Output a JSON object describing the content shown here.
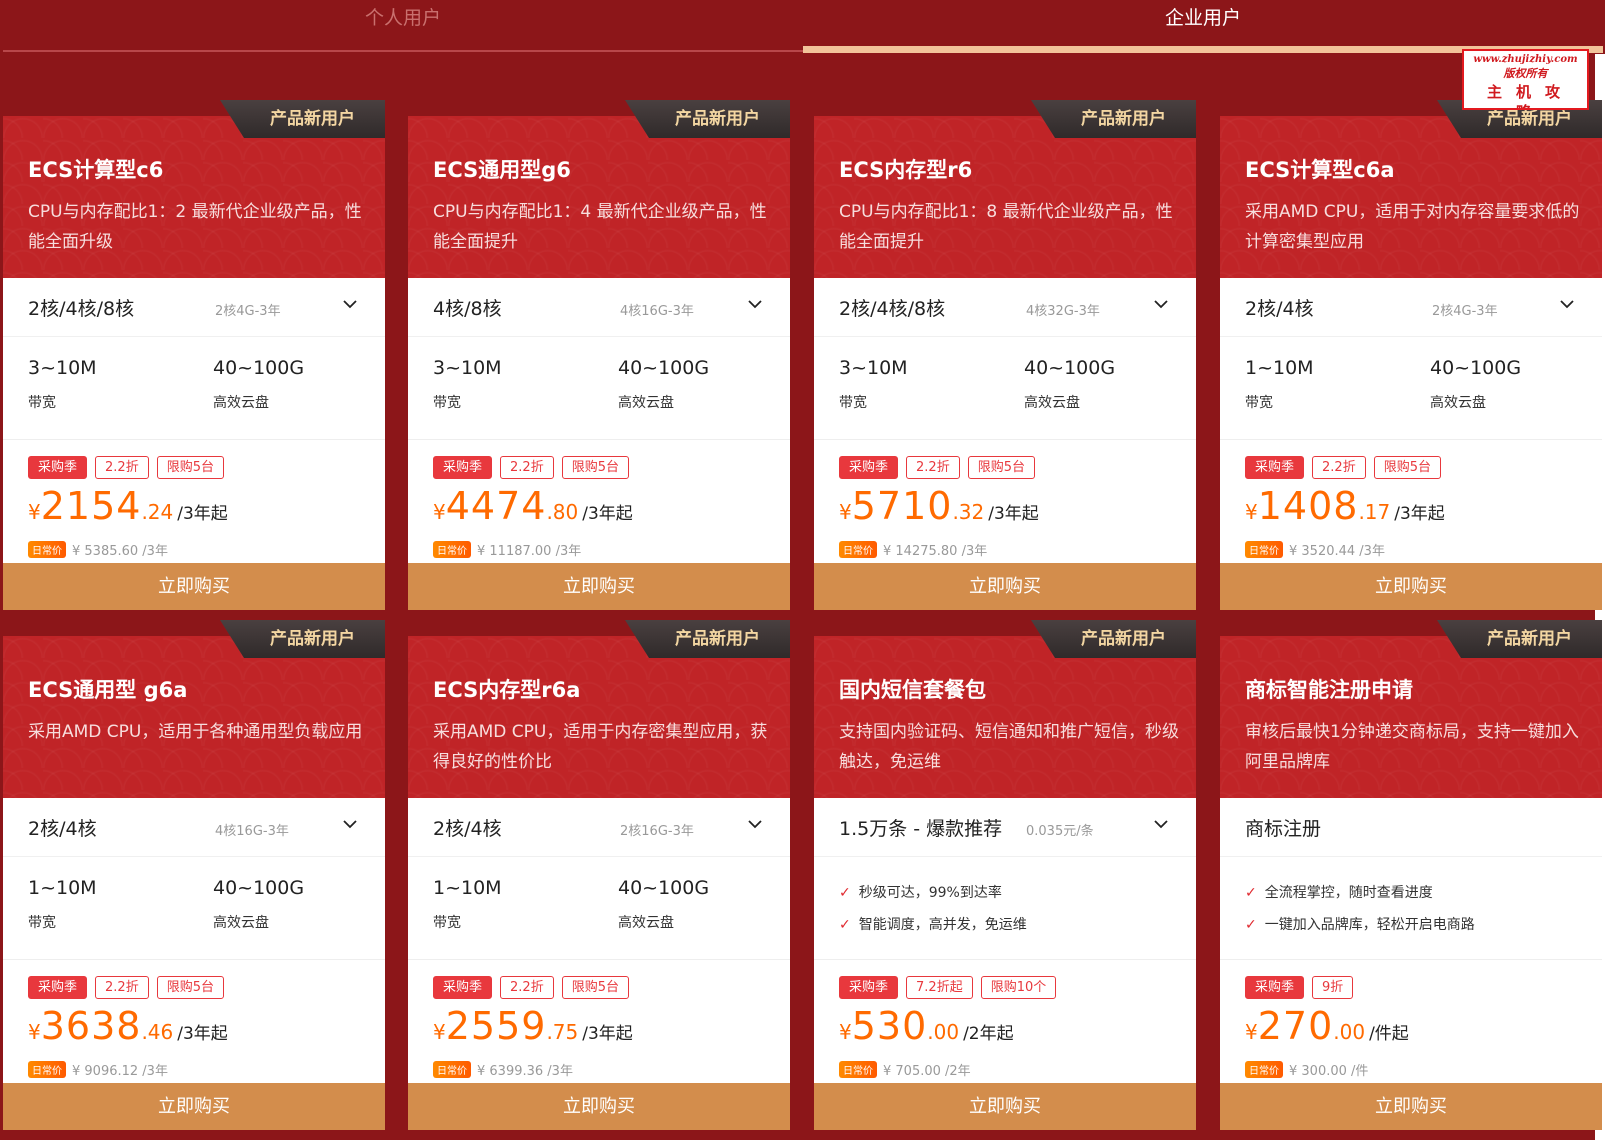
{
  "tabs": {
    "personal": "个人用户",
    "enterprise": "企业用户"
  },
  "watermark": {
    "line1": "www.zhujizhiy.com",
    "line2": "版权所有",
    "line3": "主机攻略"
  },
  "common": {
    "badge": "产品新用户",
    "buy": "立即购买",
    "currency": "¥",
    "orig_label": "日常价",
    "bandwidth_label": "带宽",
    "disk_label": "高效云盘"
  },
  "cards": [
    {
      "title": "ECS计算型c6",
      "desc": "CPU与内存配比1：2 最新代企业级产品，性能全面升级",
      "selector_main": "2核/4核/8核",
      "selector_sub": "2核4G-3年",
      "bandwidth": "3~10M",
      "disk": "40~100G",
      "tags": [
        "采购季",
        "2.2折",
        "限购5台"
      ],
      "price_int": "2154",
      "price_dec": ".24",
      "price_unit": "/3年起",
      "orig": "¥ 5385.60 /3年"
    },
    {
      "title": "ECS通用型g6",
      "desc": "CPU与内存配比1：4 最新代企业级产品，性能全面提升",
      "selector_main": "4核/8核",
      "selector_sub": "4核16G-3年",
      "bandwidth": "3~10M",
      "disk": "40~100G",
      "tags": [
        "采购季",
        "2.2折",
        "限购5台"
      ],
      "price_int": "4474",
      "price_dec": ".80",
      "price_unit": "/3年起",
      "orig": "¥ 11187.00 /3年"
    },
    {
      "title": "ECS内存型r6",
      "desc": "CPU与内存配比1：8 最新代企业级产品，性能全面提升",
      "selector_main": "2核/4核/8核",
      "selector_sub": "4核32G-3年",
      "bandwidth": "3~10M",
      "disk": "40~100G",
      "tags": [
        "采购季",
        "2.2折",
        "限购5台"
      ],
      "price_int": "5710",
      "price_dec": ".32",
      "price_unit": "/3年起",
      "orig": "¥ 14275.80 /3年"
    },
    {
      "title": "ECS计算型c6a",
      "desc": "采用AMD CPU，适用于对内存容量要求低的计算密集型应用",
      "selector_main": "2核/4核",
      "selector_sub": "2核4G-3年",
      "bandwidth": "1~10M",
      "disk": "40~100G",
      "tags": [
        "采购季",
        "2.2折",
        "限购5台"
      ],
      "price_int": "1408",
      "price_dec": ".17",
      "price_unit": "/3年起",
      "orig": "¥ 3520.44 /3年"
    },
    {
      "title": "ECS通用型 g6a",
      "desc": "采用AMD CPU，适用于各种通用型负载应用",
      "selector_main": "2核/4核",
      "selector_sub": "4核16G-3年",
      "bandwidth": "1~10M",
      "disk": "40~100G",
      "tags": [
        "采购季",
        "2.2折",
        "限购5台"
      ],
      "price_int": "3638",
      "price_dec": ".46",
      "price_unit": "/3年起",
      "orig": "¥ 9096.12 /3年"
    },
    {
      "title": "ECS内存型r6a",
      "desc": "采用AMD CPU，适用于内存密集型应用，获得良好的性价比",
      "selector_main": "2核/4核",
      "selector_sub": "2核16G-3年",
      "bandwidth": "1~10M",
      "disk": "40~100G",
      "tags": [
        "采购季",
        "2.2折",
        "限购5台"
      ],
      "price_int": "2559",
      "price_dec": ".75",
      "price_unit": "/3年起",
      "orig": "¥ 6399.36 /3年"
    },
    {
      "title": "国内短信套餐包",
      "desc": "支持国内验证码、短信通知和推广短信，秒级触达，免运维",
      "selector_main": "1.5万条 - 爆款推荐",
      "selector_sub": "0.035元/条",
      "features": [
        "秒级可达，99%到达率",
        "智能调度，高并发，免运维"
      ],
      "tags": [
        "采购季",
        "7.2折起",
        "限购10个"
      ],
      "price_int": "530",
      "price_dec": ".00",
      "price_unit": "/2年起",
      "orig": "¥ 705.00 /2年"
    },
    {
      "title": "商标智能注册申请",
      "desc": "审核后最快1分钟递交商标局，支持一键加入阿里品牌库",
      "selector_main": "商标注册",
      "selector_sub": "",
      "features": [
        "全流程掌控，随时查看进度",
        "一键加入品牌库，轻松开启电商路"
      ],
      "tags": [
        "采购季",
        "9折"
      ],
      "price_int": "270",
      "price_dec": ".00",
      "price_unit": "/件起",
      "orig": "¥ 300.00 /件"
    }
  ]
}
